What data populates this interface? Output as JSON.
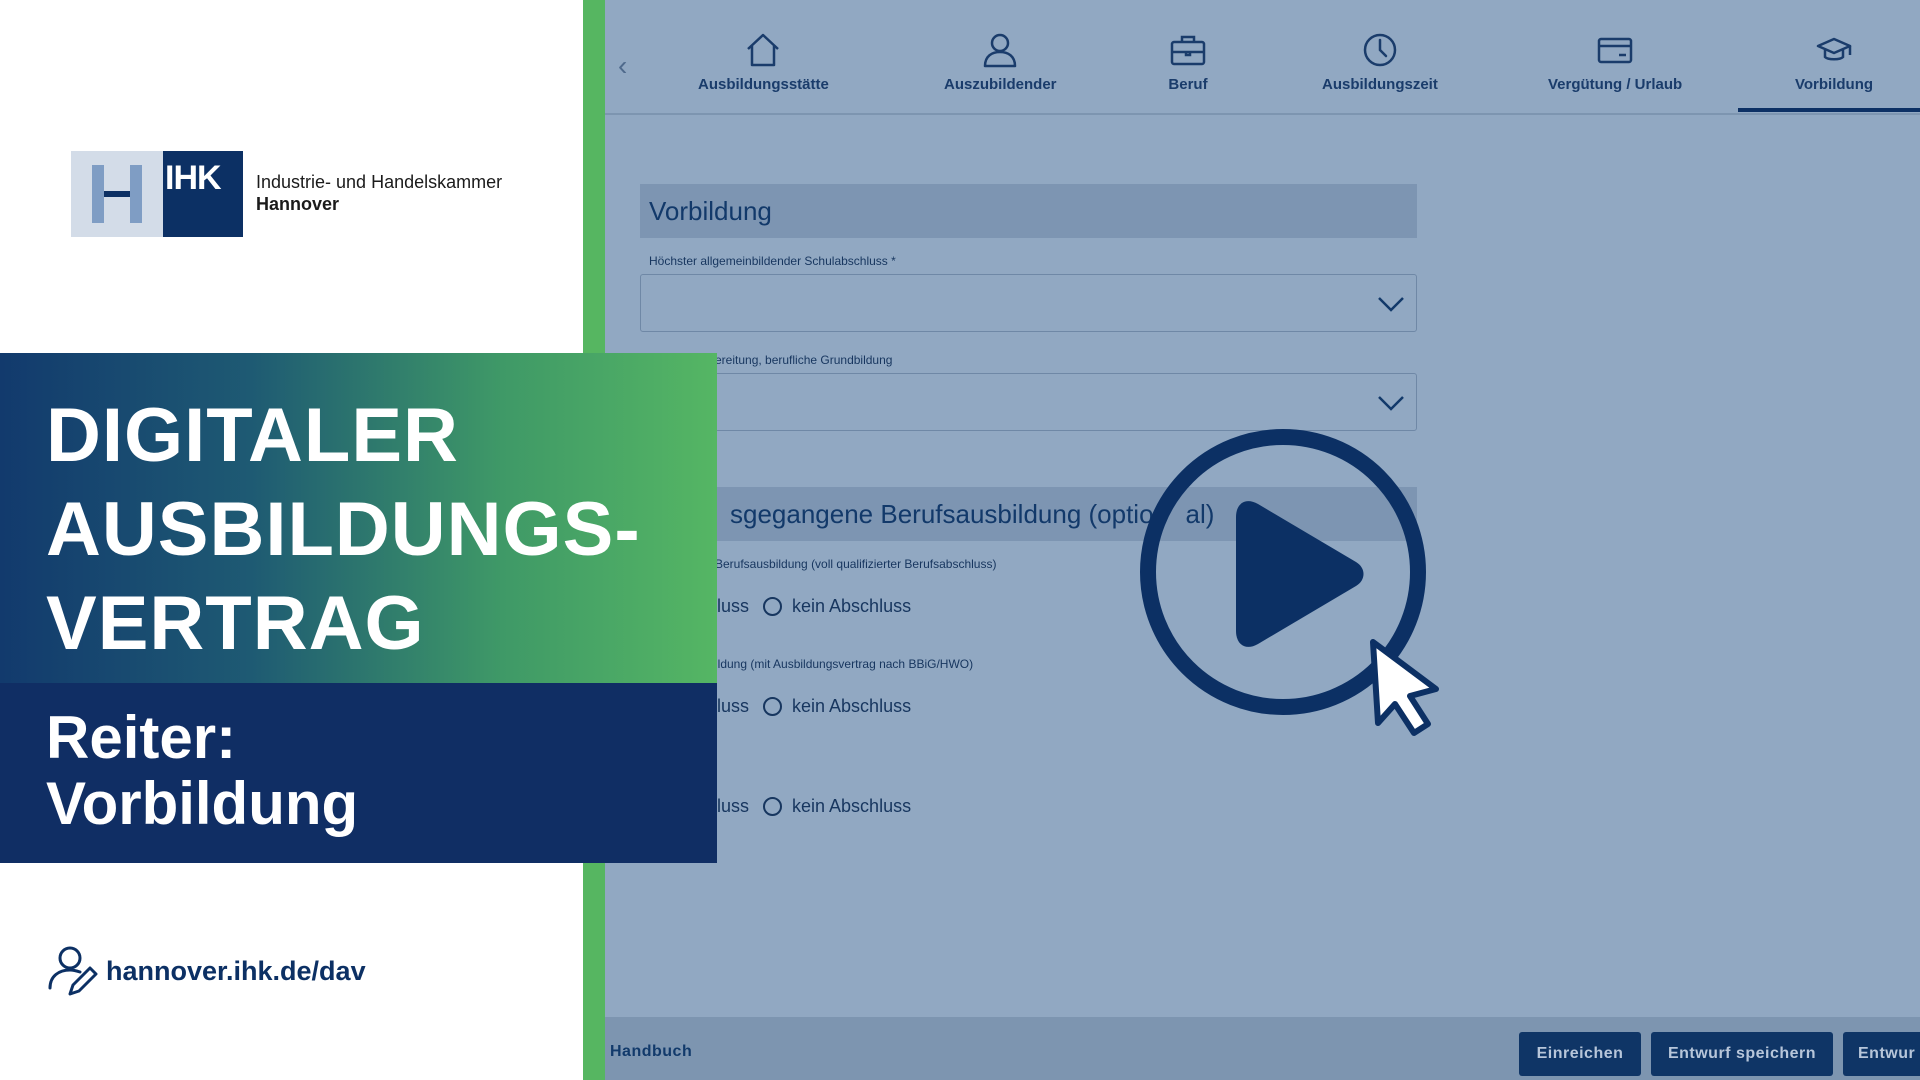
{
  "logo": {
    "abbr": "IHK",
    "line1": "Industrie- und Handelskammer",
    "line2": "Hannover"
  },
  "overlay": {
    "title_lines": [
      "DIGITALER",
      "AUSBILDUNGS-",
      "VERTRAG"
    ],
    "subtitle_lines": [
      "Reiter:",
      "Vorbildung"
    ],
    "link": "hannover.ihk.de/dav"
  },
  "app": {
    "tabs": [
      {
        "label": "Ausbildungsstätte",
        "icon": "house-icon"
      },
      {
        "label": "Auszubildender",
        "icon": "person-icon"
      },
      {
        "label": "Beruf",
        "icon": "briefcase-icon"
      },
      {
        "label": "Ausbildungszeit",
        "icon": "clock-icon"
      },
      {
        "label": "Vergütung / Urlaub",
        "icon": "card-icon"
      },
      {
        "label": "Vorbildung",
        "icon": "graduation-cap-icon",
        "active": true
      }
    ],
    "section1_title": "Vorbildung",
    "field1_label": "Höchster allgemeinbildender Schulabschluss *",
    "field2_label": "ereitung, berufliche Grundbildung",
    "section2_title": "sgegangene Berufsausbildung (optio",
    "section2_title_end": "al)",
    "field3_label": "Berufsausbildung (voll qualifizierter Berufsabschluss)",
    "field4_label": "ildung (mit Ausbildungsvertrag nach BBiG/HWO)",
    "radio_partial": "luss",
    "radio_none": "kein Abschluss",
    "handbuch": "Handbuch",
    "buttons": [
      "Einreichen",
      "Entwurf speichern",
      "Entwur"
    ]
  },
  "colors": {
    "brand_dark_blue": "#0c3064",
    "brand_green": "#56b661",
    "dimmed_app_bg": "#91a8c2"
  }
}
